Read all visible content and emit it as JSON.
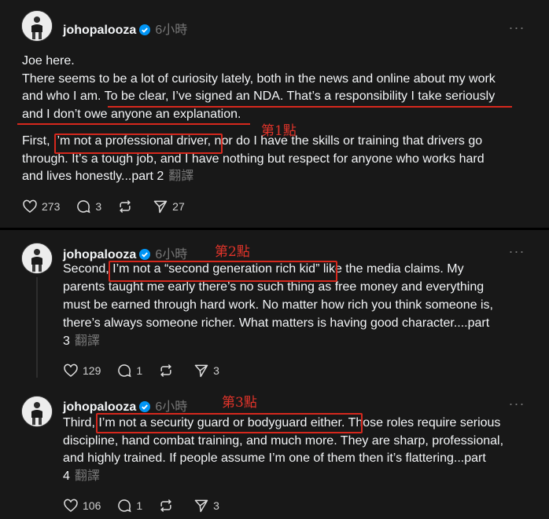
{
  "accent": {
    "verified": "#0095f6",
    "annotation": "#d6281d"
  },
  "posts": [
    {
      "username": "johopalooza",
      "time": "6小時",
      "line1": "Joe here.",
      "line2": "There seems to be a lot of curiosity lately, both in the news and online about my work",
      "line3_pre": "and who I am. ",
      "line3_hl": "To be clear, I’ve signed an NDA. That’s a responsibility I take seriously",
      "line4_hl": "and I don’t owe anyone an explanation.",
      "line5_pre": "First, ",
      "line5_hl": "I’m not a professional driver,",
      "line5_post": " nor do I have the skills or training that drivers go",
      "line6": "through. It’s a tough job, and I have nothing but respect for anyone who works hard",
      "line7": "and lives honestly...part 2",
      "translate": "翻譯",
      "likes": "273",
      "comments": "3",
      "shares": "27",
      "annotation": "第1點"
    },
    {
      "username": "johopalooza",
      "time": "6小時",
      "line1_pre": "Second, ",
      "line1_hl": "I’m not a “second generation rich kid”",
      "line1_post": " like the media claims. My",
      "line2": "parents taught me early there’s no such thing as free money and everything",
      "line3": "must be earned through hard work. No matter how rich you think someone is,",
      "line4": "there’s always someone richer. What matters is having good character....part",
      "line5": "3",
      "translate": "翻譯",
      "likes": "129",
      "comments": "1",
      "shares": "3",
      "annotation": "第2點"
    },
    {
      "username": "johopalooza",
      "time": "6小時",
      "line1_pre": "Third, ",
      "line1_hl": "I’m not a security guard or bodyguard either.",
      "line1_post": " Those roles require serious",
      "line2": "discipline, hand combat training, and much more. They are sharp, professional,",
      "line3": "and highly trained. If people assume I’m one of them then it’s flattering...part",
      "line4": "4",
      "translate": "翻譯",
      "likes": "106",
      "comments": "1",
      "shares": "3",
      "annotation": "第3點"
    }
  ]
}
